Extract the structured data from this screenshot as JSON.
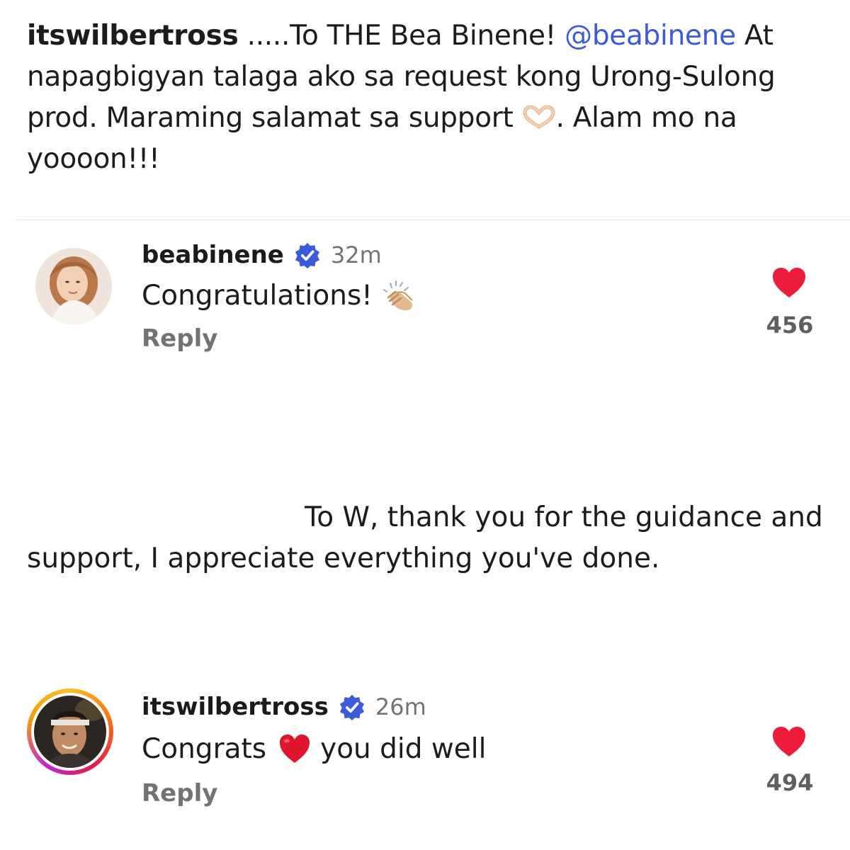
{
  "caption": {
    "username": "itswilbertross",
    "prefix": " .....To THE Bea Binene! ",
    "mention": "@beabinene",
    "text_after_mention": " At napagbigyan talaga ako sa request kong Urong-Sulong prod. Maraming salamat sa support ",
    "text_end": ". Alam mo na yoooon!!!",
    "emoji": "heart-hands-icon"
  },
  "comments": [
    {
      "username": "beabinene",
      "verified": true,
      "time": "32m",
      "text": "Congratulations!",
      "emoji": "clapping-hands-icon",
      "reply_label": "Reply",
      "likes": "456"
    },
    {
      "username": "itswilbertross",
      "verified": true,
      "time": "26m",
      "text_before": "Congrats",
      "emoji": "red-heart-icon",
      "text_after": "you did well",
      "reply_label": "Reply",
      "likes": "494"
    }
  ],
  "middle_text": "To W, thank you for the guidance and support, I appreciate everything you've done.",
  "colors": {
    "mention": "#3b5bdb",
    "verified": "#3b5bdb",
    "like_heart": "#ed1c3a",
    "muted": "#737373"
  }
}
